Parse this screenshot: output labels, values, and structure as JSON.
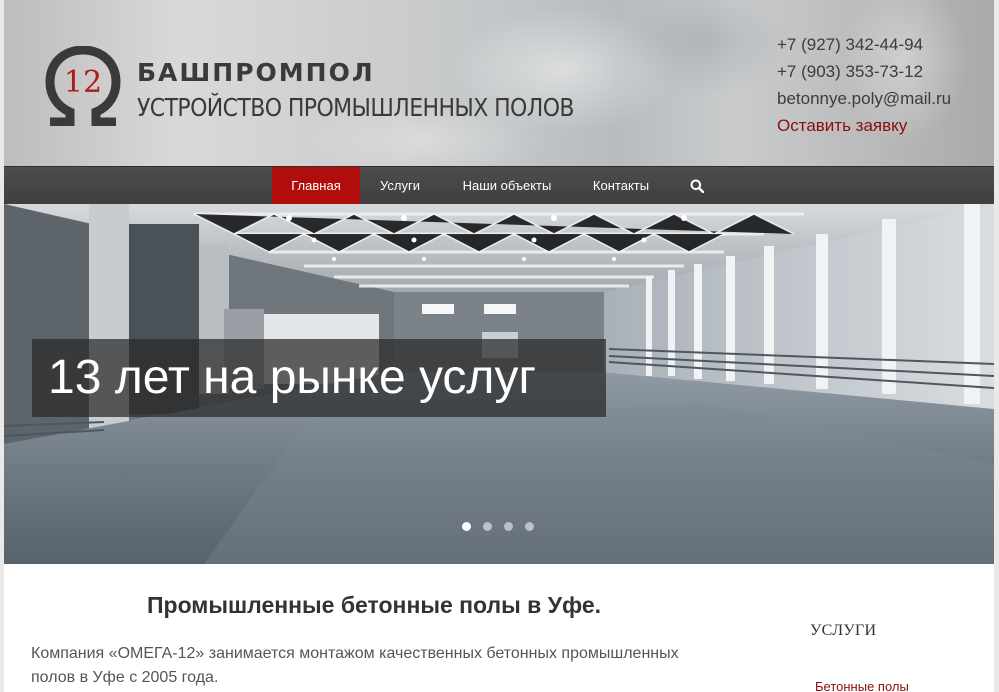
{
  "header": {
    "logo_number": "12",
    "brand": "БАШПРОМПОЛ",
    "tagline": "УСТРОЙСТВО ПРОМЫШЛЕННЫХ ПОЛОВ",
    "phone1": "+7 (927) 342-44-94",
    "phone2": "+7 (903) 353-73-12",
    "email": "betonnye.poly@mail.ru",
    "cta": "Оставить заявку"
  },
  "nav": {
    "items": [
      {
        "label": "Главная",
        "active": true
      },
      {
        "label": "Услуги"
      },
      {
        "label": "Наши объекты"
      },
      {
        "label": "Контакты"
      }
    ],
    "search_icon": "search-icon"
  },
  "slider": {
    "caption": "13 лет на рынке услуг",
    "slide_count": 4,
    "active_index": 0
  },
  "content": {
    "title": "Промышленные бетонные полы в Уфе.",
    "text": "Компания «ОМЕГА-12» занимается монтажом качественных бетонных промышленных полов в Уфе с 2005 года."
  },
  "sidebar": {
    "title": "УСЛУГИ",
    "items": [
      "Бетонные полы"
    ]
  },
  "colors": {
    "accent": "#b10d0d",
    "link": "#8b0e0e",
    "nav_bg": "#444444"
  }
}
